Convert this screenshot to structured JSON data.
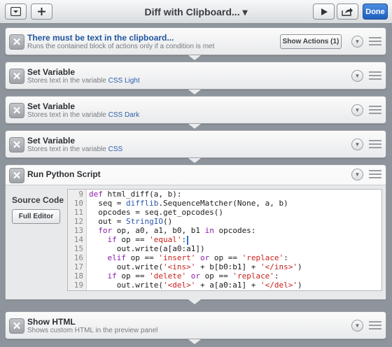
{
  "toolbar": {
    "title": "Diff with Clipboard...",
    "title_chevron": "▾",
    "done_label": "Done",
    "icons": [
      "dropdown-box-icon",
      "plus-icon",
      "play-icon",
      "share-icon"
    ]
  },
  "actions": [
    {
      "title": "There must be text in the clipboard...",
      "subtitle": "Runs the contained block of actions only if a condition is met",
      "button": "Show Actions (1)"
    },
    {
      "title": "Set Variable",
      "sub_prefix": "Stores text in the variable ",
      "variable": "CSS Light"
    },
    {
      "title": "Set Variable",
      "sub_prefix": "Stores text in the variable ",
      "variable": "CSS Dark"
    },
    {
      "title": "Set Variable",
      "sub_prefix": "Stores text in the variable ",
      "variable": "CSS"
    },
    {
      "title": "Run Python Script",
      "source_label": "Source Code",
      "editor_button": "Full Editor"
    },
    {
      "title": "Show HTML",
      "subtitle": "Shows custom HTML in the preview panel"
    }
  ],
  "code_lines": [
    {
      "n": "9",
      "t": "def html_diff(a, b):"
    },
    {
      "n": "10",
      "t": "  seq = difflib.SequenceMatcher(None, a, b)"
    },
    {
      "n": "11",
      "t": "  opcodes = seq.get_opcodes()"
    },
    {
      "n": "12",
      "t": "  out = StringIO()"
    },
    {
      "n": "13",
      "t": "  for op, a0, a1, b0, b1 in opcodes:"
    },
    {
      "n": "14",
      "t": "    if op == 'equal':"
    },
    {
      "n": "15",
      "t": "      out.write(a[a0:a1])"
    },
    {
      "n": "16",
      "t": "    elif op == 'insert' or op == 'replace':"
    },
    {
      "n": "17",
      "t": "      out.write('<ins>' + b[b0:b1] + '</ins>')"
    },
    {
      "n": "18",
      "t": "    if op == 'delete' or op == 'replace':"
    },
    {
      "n": "19",
      "t": "      out.write('<del>' + a[a0:a1] + '</del>')"
    }
  ],
  "colors": {
    "accent": "#1f5fbf",
    "variable": "#2c5ea8",
    "condition_title": "#21569e"
  }
}
